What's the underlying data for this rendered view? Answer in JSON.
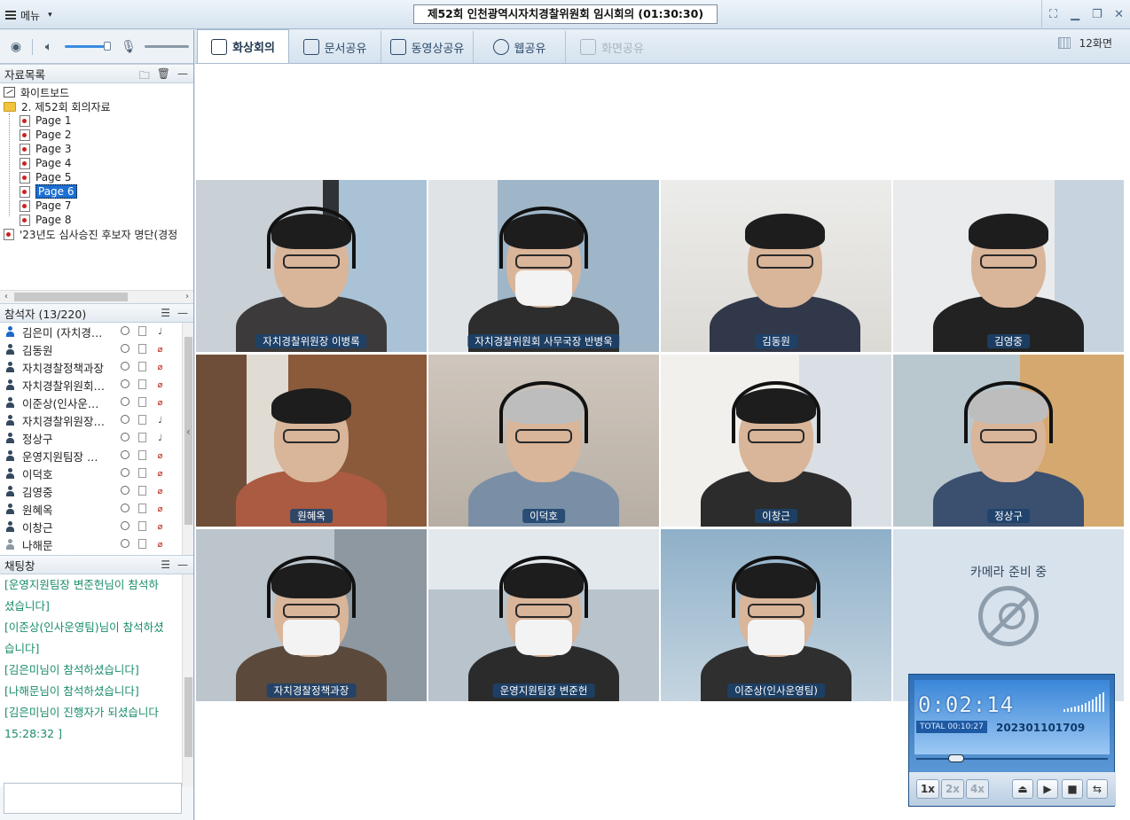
{
  "titlebar": {
    "menu_label": "메뉴",
    "meeting_title": "제52회 인천광역시자치경찰위원회 임시회의 (01:30:30)"
  },
  "files": {
    "header": "자료목록",
    "items": [
      {
        "label": "화이트보드",
        "kind": "whiteboard"
      },
      {
        "label": "2. 제52회 회의자료",
        "kind": "folder"
      },
      {
        "label": "Page 1",
        "kind": "page"
      },
      {
        "label": "Page 2",
        "kind": "page"
      },
      {
        "label": "Page 3",
        "kind": "page"
      },
      {
        "label": "Page 4",
        "kind": "page"
      },
      {
        "label": "Page 5",
        "kind": "page"
      },
      {
        "label": "Page 6",
        "kind": "page",
        "selected": true
      },
      {
        "label": "Page 7",
        "kind": "page"
      },
      {
        "label": "Page 8",
        "kind": "page"
      },
      {
        "label": "'23년도 심사승진 후보자 명단(경정",
        "kind": "doc"
      }
    ]
  },
  "participants": {
    "header": "참석자 (13/220)",
    "items": [
      {
        "name": "김은미 (자치경…",
        "mic_muted": false,
        "host": true
      },
      {
        "name": "김동원",
        "mic_muted": true
      },
      {
        "name": "자치경찰정책과장",
        "mic_muted": true
      },
      {
        "name": "자치경찰위원회…",
        "mic_muted": true
      },
      {
        "name": "이준상(인사운…",
        "mic_muted": true
      },
      {
        "name": "자치경찰위원장…",
        "mic_muted": false
      },
      {
        "name": "정상구",
        "mic_muted": false
      },
      {
        "name": "운영지원팀장 …",
        "mic_muted": true
      },
      {
        "name": "이덕호",
        "mic_muted": true
      },
      {
        "name": "김영중",
        "mic_muted": true
      },
      {
        "name": "원혜옥",
        "mic_muted": true
      },
      {
        "name": "이창근",
        "mic_muted": true
      },
      {
        "name": "나해문",
        "mic_muted": true,
        "offline": true
      }
    ]
  },
  "chat": {
    "header": "채팅창",
    "lines": [
      "[운영지원팀장 변준헌님이 참석하셨습니다]",
      "[이준상(인사운영팀)님이 참석하셨습니다]",
      "[김은미님이 참석하셨습니다]",
      "[나해문님이 참석하셨습니다]",
      "[김은미님이 진행자가 되셨습니다 15:28:32 ]"
    ]
  },
  "tabs": [
    {
      "label": "화상회의",
      "active": true
    },
    {
      "label": "문서공유"
    },
    {
      "label": "동영상공유"
    },
    {
      "label": "웹공유"
    },
    {
      "label": "화면공유",
      "disabled": true
    }
  ],
  "layout_label": "12화면",
  "video_tiles": [
    {
      "name": "자치경찰위원장 이병록",
      "mask": false
    },
    {
      "name": "자치경찰위원회 사무국장 반병욱",
      "mask": true
    },
    {
      "name": "김동원",
      "mask": false
    },
    {
      "name": "김영중",
      "mask": false
    },
    {
      "name": "원혜옥",
      "mask": false
    },
    {
      "name": "이덕호",
      "mask": false
    },
    {
      "name": "이창근",
      "mask": false
    },
    {
      "name": "정상구",
      "mask": false
    },
    {
      "name": "자치경찰정책과장",
      "mask": true
    },
    {
      "name": "운영지원팀장 변준헌",
      "mask": true
    },
    {
      "name": "이준상(인사운영팀)",
      "mask": true
    }
  ],
  "camera_placeholder": "카메라 준비 중",
  "recorder": {
    "elapsed": "0:02:14",
    "total": "TOTAL 00:10:27",
    "recording_id": "202301101709",
    "speeds": [
      "1x",
      "2x",
      "4x"
    ],
    "progress": 0.21
  },
  "colors": {
    "accent": "#1d6fd2",
    "chat_text": "#1a8c6c",
    "name_tag": "#1c426e"
  }
}
